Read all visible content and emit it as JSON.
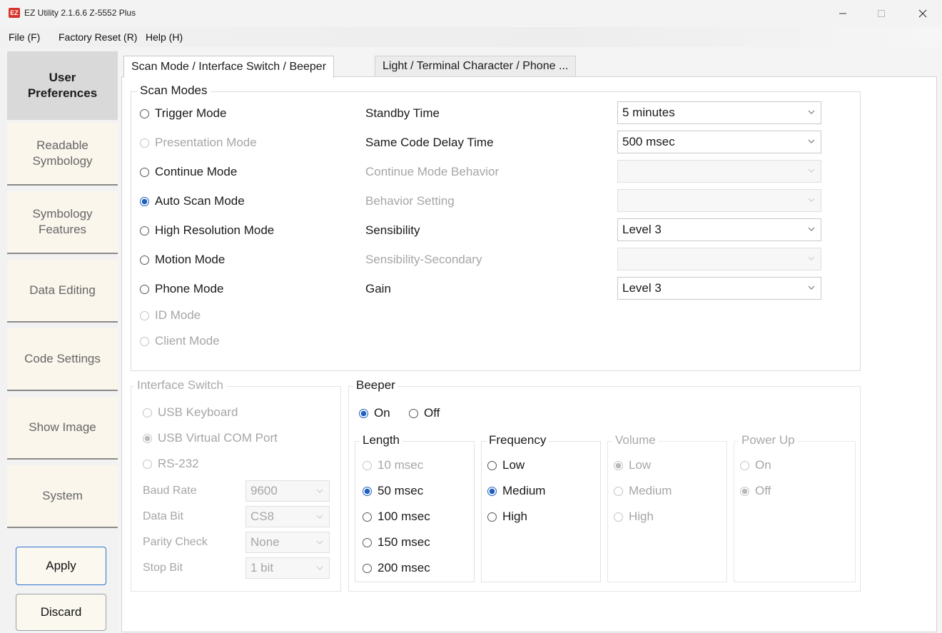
{
  "window": {
    "title": "EZ Utility 2.1.6.6 Z-5552 Plus",
    "icon_text": "EZ"
  },
  "menu": [
    "File (F)",
    "Factory Reset (R)",
    "Help (H)"
  ],
  "sidebar": {
    "items": [
      "User\nPreferences",
      "Readable\nSymbology",
      "Symbology\nFeatures",
      "Data Editing",
      "Code Settings",
      "Show Image",
      "System"
    ],
    "apply_label": "Apply",
    "discard_label": "Discard"
  },
  "tabs": [
    "Scan Mode / Interface Switch / Beeper",
    "Light / Terminal Character / Phone ..."
  ],
  "scan_modes": {
    "title": "Scan Modes",
    "options": [
      "Trigger Mode",
      "Presentation Mode",
      "Continue Mode",
      "Auto Scan Mode",
      "High Resolution Mode",
      "Motion Mode",
      "Phone Mode",
      "ID Mode",
      "Client Mode"
    ],
    "selected": "Auto Scan Mode",
    "settings": [
      {
        "label": "Standby Time",
        "value": "5 minutes",
        "enabled": true
      },
      {
        "label": "Same Code Delay Time",
        "value": "500 msec",
        "enabled": true
      },
      {
        "label": "Continue Mode Behavior",
        "value": "",
        "enabled": false
      },
      {
        "label": "Behavior Setting",
        "value": "",
        "enabled": false
      },
      {
        "label": "Sensibility",
        "value": "Level 3",
        "enabled": true
      },
      {
        "label": "Sensibility-Secondary",
        "value": "",
        "enabled": false
      },
      {
        "label": "Gain",
        "value": "Level 3",
        "enabled": true
      }
    ]
  },
  "interface_switch": {
    "title": "Interface Switch",
    "options": [
      "USB Keyboard",
      "USB Virtual COM Port",
      "RS-232"
    ],
    "selected": "USB Virtual COM Port",
    "params": [
      {
        "label": "Baud Rate",
        "value": "9600"
      },
      {
        "label": "Data Bit",
        "value": "CS8"
      },
      {
        "label": "Parity Check",
        "value": "None"
      },
      {
        "label": "Stop Bit",
        "value": "1 bit"
      }
    ]
  },
  "beeper": {
    "title": "Beeper",
    "on_label": "On",
    "off_label": "Off",
    "state": "On",
    "length": {
      "title": "Length",
      "options": [
        "10 msec",
        "50 msec",
        "100 msec",
        "150 msec",
        "200 msec"
      ],
      "selected": "50 msec"
    },
    "frequency": {
      "title": "Frequency",
      "options": [
        "Low",
        "Medium",
        "High"
      ],
      "selected": "Medium"
    },
    "volume": {
      "title": "Volume",
      "options": [
        "Low",
        "Medium",
        "High"
      ],
      "selected": "Low"
    },
    "power_up": {
      "title": "Power Up",
      "options": [
        "On",
        "Off"
      ],
      "selected": "Off"
    }
  },
  "colors": {
    "accent": "#1f5fbf",
    "app_icon": "#d6332a",
    "sidebar_active": "#d9d9d9",
    "sidebar_bg": "#faf6ec"
  }
}
